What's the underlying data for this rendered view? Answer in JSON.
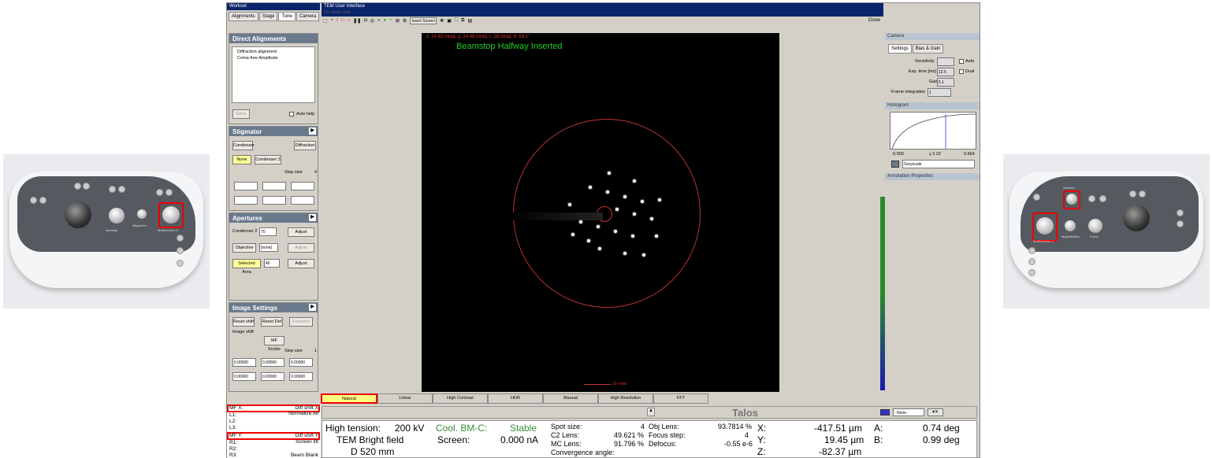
{
  "left_photo": {
    "labels": [
      "Diff Shift",
      "Alignment",
      "Multifunction X",
      "Intensity"
    ]
  },
  "right_photo": {
    "labels": [
      "Multifunction Y",
      "Magnification",
      "Focus",
      "Wobbler",
      "Eucentric focus",
      "Stigmator"
    ]
  },
  "app": {
    "left_title": "Workset",
    "tabs": [
      "Alignments",
      "Stage",
      "Tune",
      "Camera"
    ],
    "direct_alignments": {
      "title": "Direct Alignments",
      "items": [
        "Diffraction alignment",
        "Coma-free Amplitude"
      ],
      "done_label": "Done",
      "auto_help": "Auto help"
    },
    "stigmator": {
      "title": "Stigmator",
      "condenser": "Condenser",
      "diffraction": "Diffraction",
      "none": "None",
      "condenser3": "Condenser 3",
      "step_size": "Step size",
      "step_value": "4"
    },
    "apertures": {
      "title": "Apertures",
      "condenser2": "Condenser 2",
      "condenser2_value": "70",
      "adjust": "Adjust",
      "objective": "Objective",
      "objective_value": "[none]",
      "adjust2": "Adjust",
      "selected_area": "Selected Area",
      "selected_value": "40",
      "adjust3": "Adjust"
    },
    "image_settings": {
      "title": "Image Settings",
      "reset_shift": "Reset shift",
      "reset_def": "Reset Def",
      "eucentric": "Eucentric",
      "image_shift": "Image shift",
      "mf_knobs": "MF Knobs",
      "step_size": "Step size",
      "step_value": "1",
      "x_values": [
        "0.00000",
        "0.00000",
        "0.00000"
      ],
      "y_values": [
        "0.00000",
        "0.00000",
        "0.00000"
      ]
    },
    "main_title": "TEM User Interface",
    "menu": "File   Mode   Help",
    "insert_screen": "Insert Screen",
    "close": "Close",
    "viewer": {
      "overlay_coords": "x: 14.82 mrad, y: 24.48 mrad, r: 28 mrad, θ: 58.1°",
      "beamstop": "Beamstop Halfway Inserted",
      "scale": "10 mrad"
    },
    "camera_panel": {
      "title": "Camera",
      "tab1": "Settings",
      "tab2": "Bias & Gain",
      "sensitivity": "Sensitivity",
      "auto": "Auto",
      "exp_time": "Exp. time [ms]",
      "exp_value": "12.5",
      "dual": "Dual",
      "gain": "Gain",
      "gain_value": "5.1",
      "frame_integration": "Frame integration",
      "frame_value": "1"
    },
    "histogram": {
      "title": "Histogram",
      "min": "0.000",
      "gamma": "γ 2.22",
      "max": "0.664",
      "palette": "Greyscale"
    },
    "annotation": "Annotation Properties",
    "modes": [
      "Natural",
      "Linear",
      "High Contrast",
      "HDR",
      "Manual",
      "High Resolution",
      "FFT"
    ],
    "talos": "Talos",
    "preset_none": "- None -",
    "left_info": {
      "mfx_label": "MF X:",
      "mfx_value": "Diff shift X",
      "l1": "L1:",
      "l1_value": "Normalize All",
      "l2": "L2:",
      "l3": "L3:",
      "mfy_label": "MF Y:",
      "mfy_value": "Diff shift Y",
      "r1": "R1:",
      "r1_value": "Screen lift",
      "r2": "R2:",
      "r3": "R3:",
      "r3_value": "Beam Blank"
    },
    "bottom": {
      "ht_label": "High tension:",
      "ht_value": "200 kV",
      "cool_label": "Cool. BM-C:",
      "cool_value": "Stable",
      "mode": "TEM Bright field",
      "screen_label": "Screen:",
      "screen_value": "0.000 nA",
      "camera_length": "D 520 mm",
      "spot_label": "Spot size:",
      "spot_value": "4",
      "c2_label": "C2 Lens:",
      "c2_value": "49.621 %",
      "mc_label": "MC Lens:",
      "mc_value": "91.796 %",
      "conv_label": "Convergence angle:",
      "obj_label": "Obj Lens:",
      "obj_value": "93.7814 %",
      "focus_label": "Focus step:",
      "focus_value": "4",
      "defocus_label": "Defocus:",
      "defocus_value": "-0.55 e-6",
      "x_label": "X:",
      "x_value": "-417.51 µm",
      "a_label": "A:",
      "a_value": "0.74 deg",
      "y_label": "Y:",
      "y_value": "19.45 µm",
      "b_label": "B:",
      "b_value": "0.99 deg",
      "z_label": "Z:",
      "z_value": "-82.37 µm"
    }
  }
}
